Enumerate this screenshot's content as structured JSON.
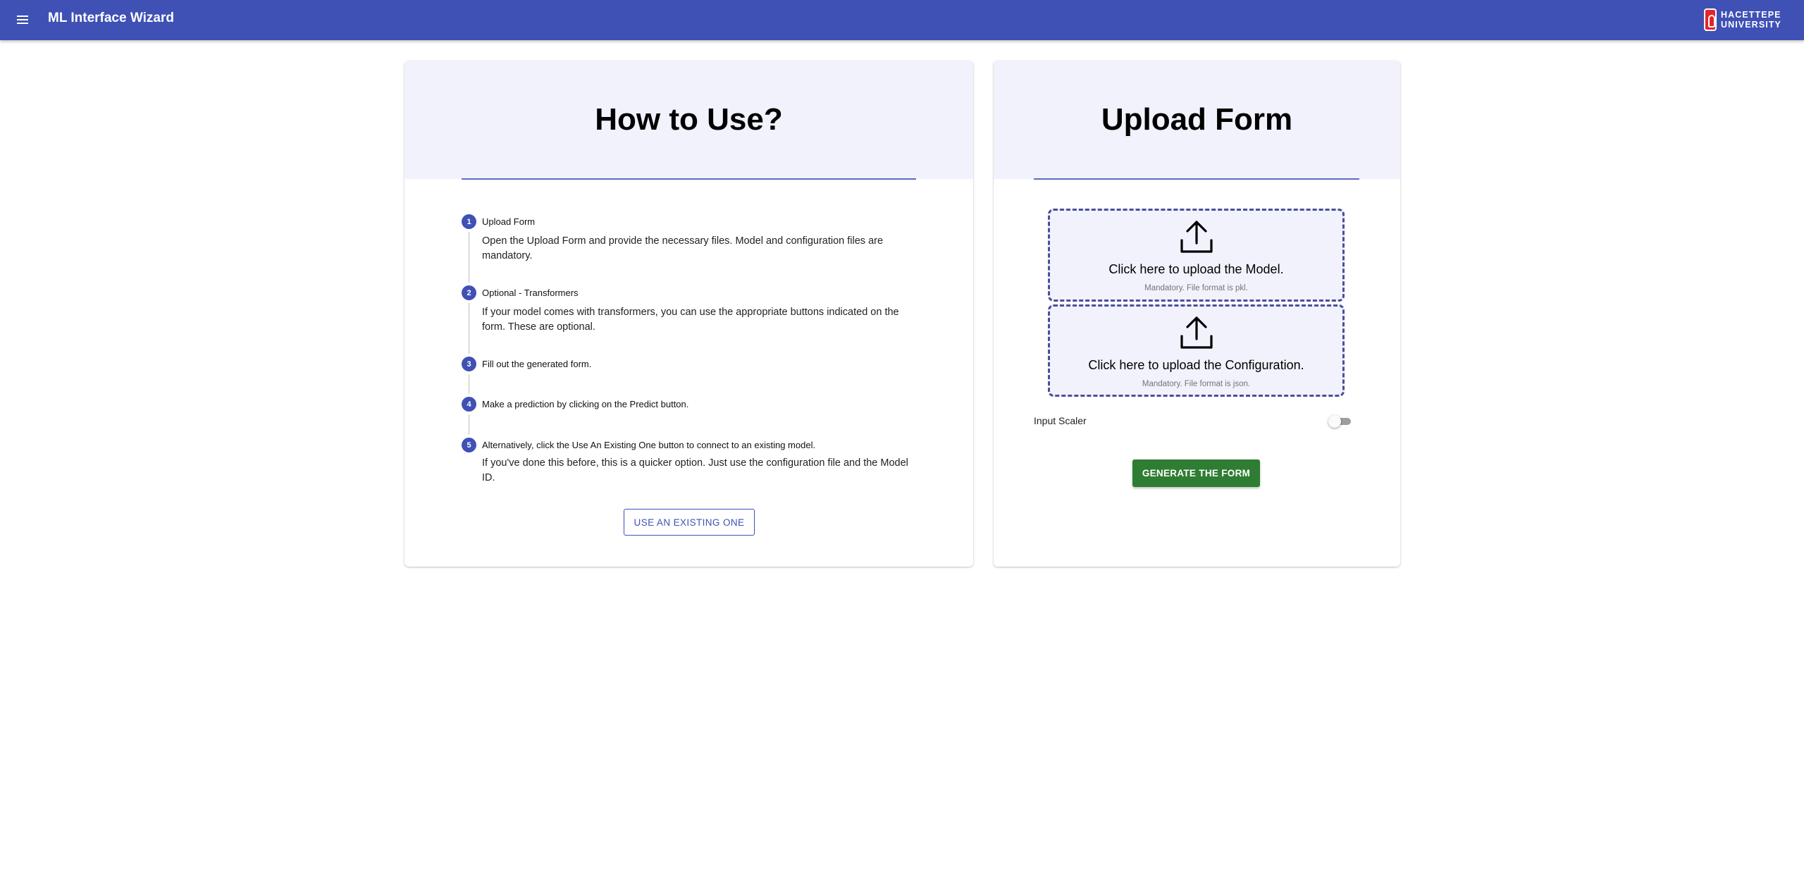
{
  "appbar": {
    "title": "ML Interface Wizard",
    "logo_line1": "HACETTEPE",
    "logo_line2": "UNIVERSITY",
    "color": "#3f51b5"
  },
  "how_to_use": {
    "title": "How to Use?",
    "steps": [
      {
        "number": "1",
        "label": "Upload Form",
        "description": "Open the Upload Form and provide the necessary files. Model and configuration files are mandatory."
      },
      {
        "number": "2",
        "label": "Optional - Transformers",
        "description": "If your model comes with transformers, you can use the appropriate buttons indicated on the form. These are optional."
      },
      {
        "number": "3",
        "label": "Fill out the generated form.",
        "description": ""
      },
      {
        "number": "4",
        "label": "Make a prediction by clicking on the Predict button.",
        "description": ""
      },
      {
        "number": "5",
        "label": "Alternatively, click the Use An Existing One button to connect to an existing model.",
        "description": "If you've done this before, this is a quicker option. Just use the configuration file and the Model ID."
      }
    ],
    "existing_button": "USE AN EXISTING ONE"
  },
  "upload_form": {
    "title": "Upload Form",
    "model_upload": {
      "title": "Click here to upload the Model.",
      "hint": "Mandatory. File format is pkl.",
      "icon": "upload-icon"
    },
    "config_upload": {
      "title": "Click here to upload the Configuration.",
      "hint": "Mandatory. File format is json.",
      "icon": "upload-icon"
    },
    "input_scaler_label": "Input Scaler",
    "input_scaler_enabled": false,
    "generate_button": "GENERATE THE FORM",
    "generate_color": "#2e7d32"
  }
}
